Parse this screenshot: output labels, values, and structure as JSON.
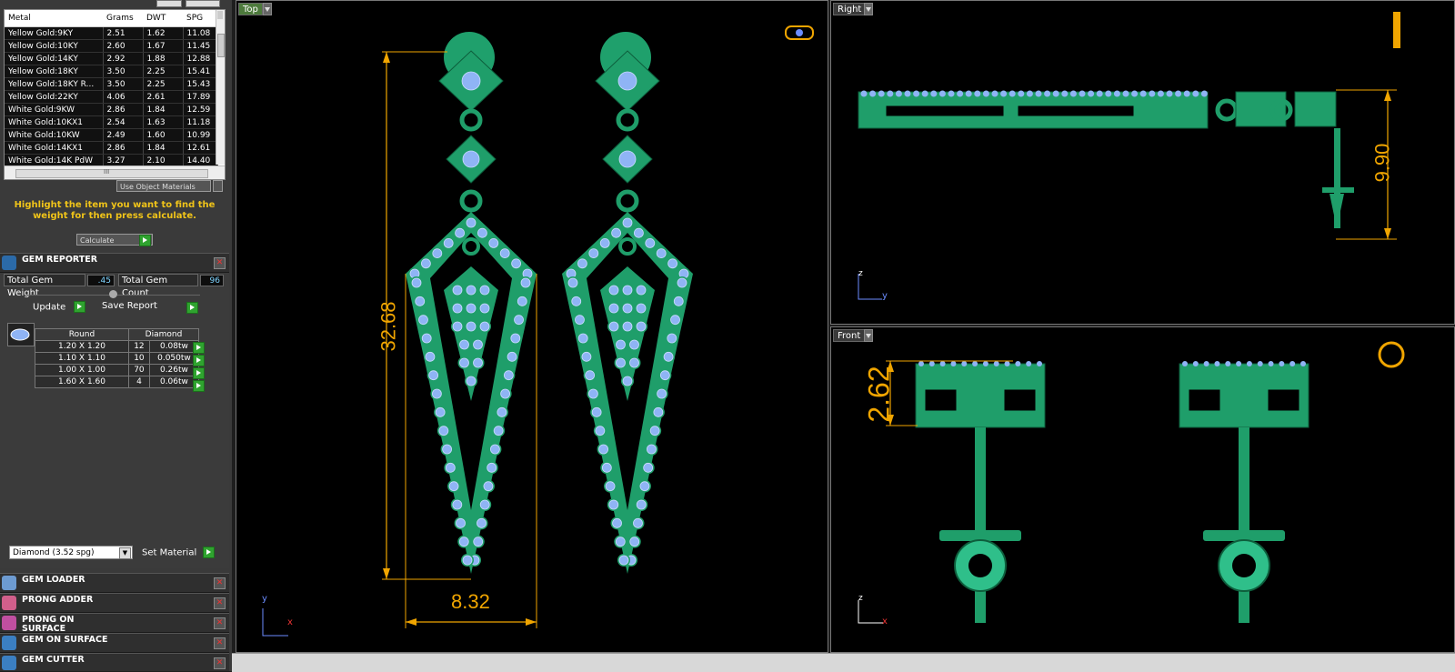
{
  "metal_table": {
    "headers": [
      "Metal",
      "Grams",
      "DWT",
      "SPG"
    ],
    "rows": [
      [
        "Yellow Gold:9KY",
        "2.51",
        "1.62",
        "11.08"
      ],
      [
        "Yellow Gold:10KY",
        "2.60",
        "1.67",
        "11.45"
      ],
      [
        "Yellow Gold:14KY",
        "2.92",
        "1.88",
        "12.88"
      ],
      [
        "Yellow Gold:18KY",
        "3.50",
        "2.25",
        "15.41"
      ],
      [
        "Yellow Gold:18KY R...",
        "3.50",
        "2.25",
        "15.43"
      ],
      [
        "Yellow Gold:22KY",
        "4.06",
        "2.61",
        "17.89"
      ],
      [
        "White Gold:9KW",
        "2.86",
        "1.84",
        "12.59"
      ],
      [
        "White Gold:10KX1",
        "2.54",
        "1.63",
        "11.18"
      ],
      [
        "White Gold:10KW",
        "2.49",
        "1.60",
        "10.99"
      ],
      [
        "White Gold:14KX1",
        "2.86",
        "1.84",
        "12.61"
      ],
      [
        "White Gold:14K PdW",
        "3.27",
        "2.10",
        "14.40"
      ]
    ],
    "scroll_mark": "III"
  },
  "use_object_materials": "Use Object Materials",
  "hint_text": "Highlight the item you want to find the weight for then press calculate.",
  "calculate_label": "Calculate",
  "gem_reporter": {
    "title": "GEM REPORTER",
    "total_weight_label": "Total Gem Weight",
    "total_weight_value": ".45",
    "total_count_label": "Total Gem Count",
    "total_count_value": "96",
    "update_label": "Update",
    "save_report_label": "Save Report",
    "shape": "Round",
    "gem_type": "Diamond",
    "rows": [
      {
        "size": "1.20 X 1.20",
        "count": "12",
        "weight": "0.08tw"
      },
      {
        "size": "1.10 X 1.10",
        "count": "10",
        "weight": "0.050tw"
      },
      {
        "size": "1.00 X 1.00",
        "count": "70",
        "weight": "0.26tw"
      },
      {
        "size": "1.60 X 1.60",
        "count": "4",
        "weight": "0.06tw"
      }
    ],
    "material_select": "Diamond    (3.52 spg)",
    "set_material_label": "Set Material"
  },
  "panels": [
    {
      "title": "GEM LOADER",
      "icon": "gem-loader-icon"
    },
    {
      "title": "PRONG ADDER",
      "icon": "prong-adder-icon"
    },
    {
      "title": "PRONG ON SURFACE",
      "icon": "prong-on-surface-icon"
    },
    {
      "title": "GEM ON SURFACE",
      "icon": "gem-on-surface-icon"
    },
    {
      "title": "GEM CUTTER",
      "icon": "gem-cutter-icon"
    }
  ],
  "viewports": {
    "top": {
      "label": "Top",
      "dim_height": "32.68",
      "dim_width": "8.32",
      "axis_y": "y",
      "axis_x": "x"
    },
    "right": {
      "label": "Right",
      "dim": "9.90",
      "axis_z": "z",
      "axis_y": "y"
    },
    "front": {
      "label": "Front",
      "dim": "2.62",
      "axis_z": "z",
      "axis_x": "x"
    }
  },
  "colors": {
    "model_green": "#1f9e6a",
    "gem_blue": "#8fb4f5",
    "dimension": "#f0a500",
    "label_active_bg": "#4d7a3c"
  }
}
